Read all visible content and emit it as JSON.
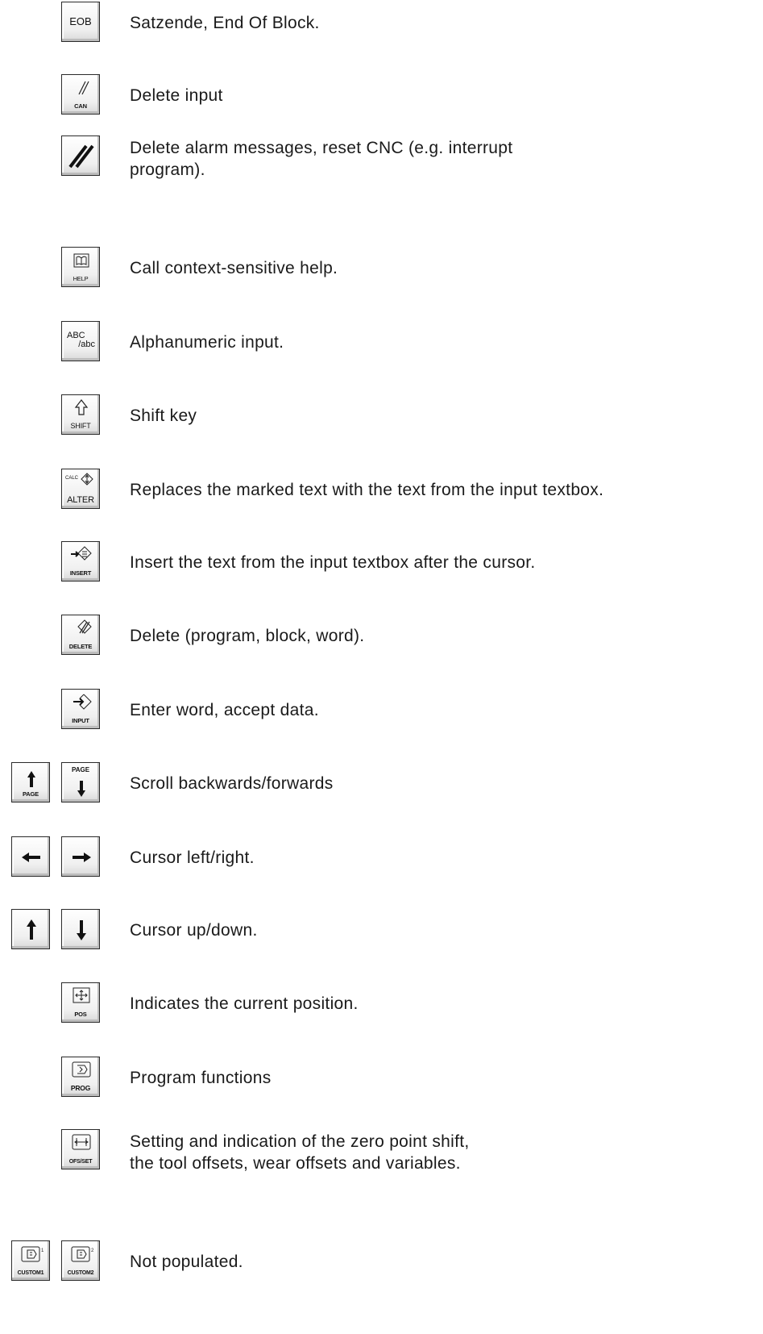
{
  "entries": [
    {
      "keys": [
        "EOB"
      ],
      "description": [
        "Satzende, End Of Block."
      ]
    },
    {
      "keys": [
        "CAN"
      ],
      "description": [
        "Delete input"
      ]
    },
    {
      "keys": [],
      "description": [
        "Delete alarm messages, reset CNC (e.g. interrupt",
        "program)."
      ]
    },
    {
      "keys": [
        "HELP"
      ],
      "description": [
        "Call context-sensitive help."
      ]
    },
    {
      "keys": [
        "ABC",
        "/abc"
      ],
      "description": [
        "Alphanumeric input."
      ]
    },
    {
      "keys": [
        "SHIFT"
      ],
      "description": [
        "Shift key"
      ]
    },
    {
      "keys": [
        "CALC",
        "ALTER"
      ],
      "description": [
        "Replaces the marked text with the text from the input textbox."
      ]
    },
    {
      "keys": [
        "INSERT"
      ],
      "description": [
        "Insert the text from the input textbox after the cursor."
      ]
    },
    {
      "keys": [
        "DELETE"
      ],
      "description": [
        "Delete (program, block, word)."
      ]
    },
    {
      "keys": [
        "INPUT"
      ],
      "description": [
        "Enter word, accept data."
      ]
    },
    {
      "keys": [
        "PAGE",
        "PAGE"
      ],
      "description": [
        "Scroll backwards/forwards"
      ]
    },
    {
      "keys": [],
      "description": [
        "Cursor left/right."
      ]
    },
    {
      "keys": [],
      "description": [
        "Cursor up/down."
      ]
    },
    {
      "keys": [
        "POS"
      ],
      "description": [
        "Indicates the current position."
      ]
    },
    {
      "keys": [
        "PROG"
      ],
      "description": [
        "Program functions"
      ]
    },
    {
      "keys": [
        "OFS/SET"
      ],
      "description": [
        "Setting and indication of the zero point shift,",
        "the tool offsets, wear offsets and variables."
      ]
    },
    {
      "keys": [
        "CUSTOM1",
        "CUSTOM2"
      ],
      "description": [
        "Not populated."
      ]
    }
  ],
  "icons": {
    "can": "double-slash-icon",
    "reset": "reset-slash-icon",
    "help": "book-icon",
    "shift": "shift-arrow-icon",
    "alter": "alter-swap-icon",
    "insert": "insert-arrow-icon",
    "delete": "delete-slash-icon",
    "input": "input-arrow-icon",
    "page_up": "arrow-up-icon",
    "page_down": "arrow-down-icon",
    "cursor_left": "arrow-left-icon",
    "cursor_right": "arrow-right-icon",
    "cursor_up": "arrow-up-icon",
    "cursor_down": "arrow-down-icon",
    "pos": "position-icon",
    "prog": "program-icon",
    "ofs": "offset-icon",
    "custom1": "custom-monitor-icon",
    "custom2": "custom-monitor-icon"
  }
}
